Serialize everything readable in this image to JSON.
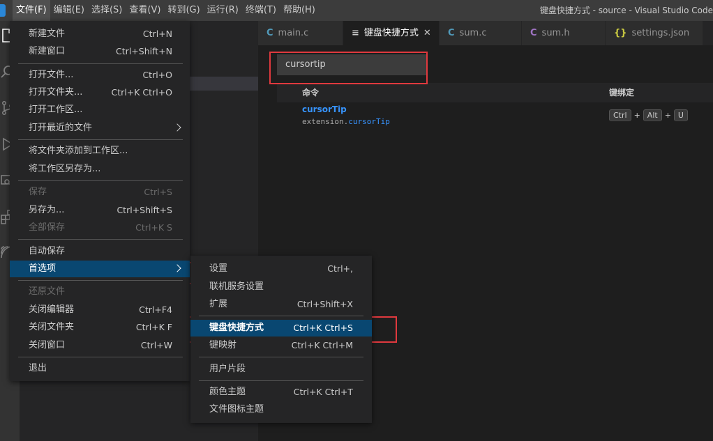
{
  "window": {
    "title": "键盘快捷方式 - source - Visual Studio Code",
    "menubar": [
      "文件(F)",
      "编辑(E)",
      "选择(S)",
      "查看(V)",
      "转到(G)",
      "运行(R)",
      "终端(T)",
      "帮助(H)"
    ]
  },
  "tabs": [
    {
      "icon": "C",
      "label": "main.c",
      "color": "#519aba"
    },
    {
      "icon": "≡",
      "label": "键盘快捷方式",
      "color": "#cccccc",
      "close": "✕"
    },
    {
      "icon": "C",
      "label": "sum.c",
      "color": "#519aba"
    },
    {
      "icon": "C",
      "label": "sum.h",
      "color": "#a074c4"
    },
    {
      "icon": "{}",
      "label": "settings.json",
      "color": "#cbcb41"
    }
  ],
  "keybindings_editor": {
    "search_value": "cursortip",
    "col_command": "命令",
    "col_keybinding": "键绑定",
    "row": {
      "title": "cursorTip",
      "id_prefix": "extension.",
      "id_highlight": "cursorTip",
      "keys": [
        "Ctrl",
        "Alt",
        "U"
      ],
      "plus": "+"
    }
  },
  "file_menu": {
    "items": [
      {
        "label": "新建文件",
        "kb": "Ctrl+N"
      },
      {
        "label": "新建窗口",
        "kb": "Ctrl+Shift+N"
      },
      {
        "label": "打开文件...",
        "kb": "Ctrl+O"
      },
      {
        "label": "打开文件夹...",
        "kb": "Ctrl+K Ctrl+O"
      },
      {
        "label": "打开工作区...",
        "kb": ""
      },
      {
        "label": "打开最近的文件",
        "kb": ""
      },
      {
        "label": "将文件夹添加到工作区...",
        "kb": ""
      },
      {
        "label": "将工作区另存为...",
        "kb": ""
      },
      {
        "label": "保存",
        "kb": "Ctrl+S"
      },
      {
        "label": "另存为...",
        "kb": "Ctrl+Shift+S"
      },
      {
        "label": "全部保存",
        "kb": "Ctrl+K S"
      },
      {
        "label": "自动保存",
        "kb": ""
      },
      {
        "label": "首选项",
        "kb": ""
      },
      {
        "label": "还原文件",
        "kb": ""
      },
      {
        "label": "关闭编辑器",
        "kb": "Ctrl+F4"
      },
      {
        "label": "关闭文件夹",
        "kb": "Ctrl+K F"
      },
      {
        "label": "关闭窗口",
        "kb": "Ctrl+W"
      },
      {
        "label": "退出",
        "kb": ""
      }
    ]
  },
  "pref_menu": {
    "items": [
      {
        "label": "设置",
        "kb": "Ctrl+,"
      },
      {
        "label": "联机服务设置",
        "kb": ""
      },
      {
        "label": "扩展",
        "kb": "Ctrl+Shift+X"
      },
      {
        "label": "键盘快捷方式",
        "kb": "Ctrl+K Ctrl+S"
      },
      {
        "label": "键映射",
        "kb": "Ctrl+K Ctrl+M"
      },
      {
        "label": "用户片段",
        "kb": ""
      },
      {
        "label": "颜色主题",
        "kb": "Ctrl+K Ctrl+T"
      },
      {
        "label": "文件图标主题",
        "kb": ""
      }
    ]
  },
  "colors": {
    "highlight": "#094771",
    "annotation_red": "#e0393e",
    "link_blue": "#3794ff"
  }
}
